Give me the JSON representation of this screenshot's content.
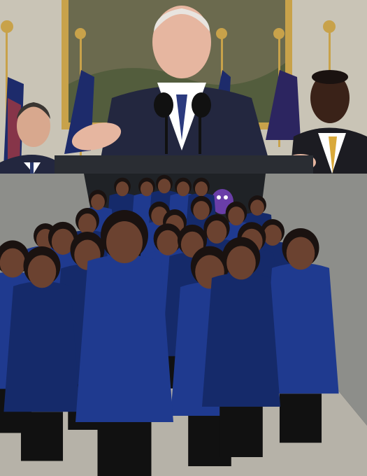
{
  "meme": {
    "panels": [
      {
        "id": "top",
        "description_key": "press-briefing-photo"
      },
      {
        "id": "bottom",
        "description_key": "crowd-procession-photo"
      }
    ]
  },
  "colors": {
    "wall": "#c9c4b6",
    "painting": "#6b6a4e",
    "frame": "#c8a24a",
    "suit_navy": "#23273f",
    "flag_blue": "#1d2b6b",
    "podium": "#2a2d33",
    "tunnel_wall": "#8d8e8a",
    "tunnel_dark": "#1f2226",
    "dress_blue": "#1f3a8f",
    "dress_shadow": "#152a6a",
    "pants": "#111111",
    "skin": "#6b4230",
    "hair": "#1a1210",
    "mascot_purple": "#6a3ea8",
    "ground": "#b6b2a8"
  }
}
